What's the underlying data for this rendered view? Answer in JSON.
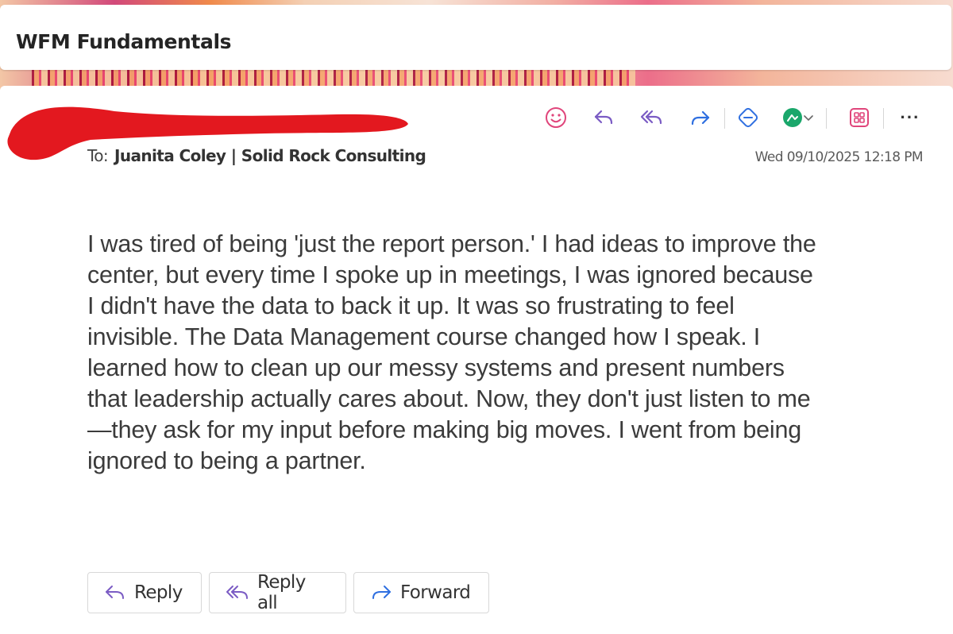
{
  "window": {
    "title": "WFM Fundamentals"
  },
  "header": {
    "to_label": "To:",
    "recipient": "Juanita Coley | Solid Rock Consulting",
    "timestamp": "Wed 09/10/2025 12:18 PM",
    "sender_redaction_color": "#e3181f"
  },
  "toolbar": {
    "icons": [
      "smiley-icon",
      "reply-icon",
      "reply-all-icon",
      "forward-icon",
      "copilot-icon",
      "app-icon",
      "chevron-down-icon",
      "apps-grid-icon",
      "more-icon"
    ],
    "more_label": "···"
  },
  "message": {
    "lines": [
      "I was tired of being 'just the report person.' I had ideas to improve the",
      "center, but every time I spoke up in meetings, I was ignored because",
      "I didn't have the data to back it up. It was so frustrating to feel",
      "invisible. The Data Management course changed how I speak. I",
      "learned how to clean up our messy systems and present numbers",
      "that leadership actually cares about. Now, they don't just listen to me",
      "—they ask for my input before making big moves. I went from being",
      "ignored to being a partner."
    ]
  },
  "actions": {
    "reply_label": "Reply",
    "reply_all_label": "Reply all",
    "forward_label": "Forward"
  },
  "colors": {
    "emoji_pink": "#e0457b",
    "reply_purple": "#7b5cc4",
    "forward_blue": "#2f6fe0",
    "app_green": "#1aa76b"
  }
}
